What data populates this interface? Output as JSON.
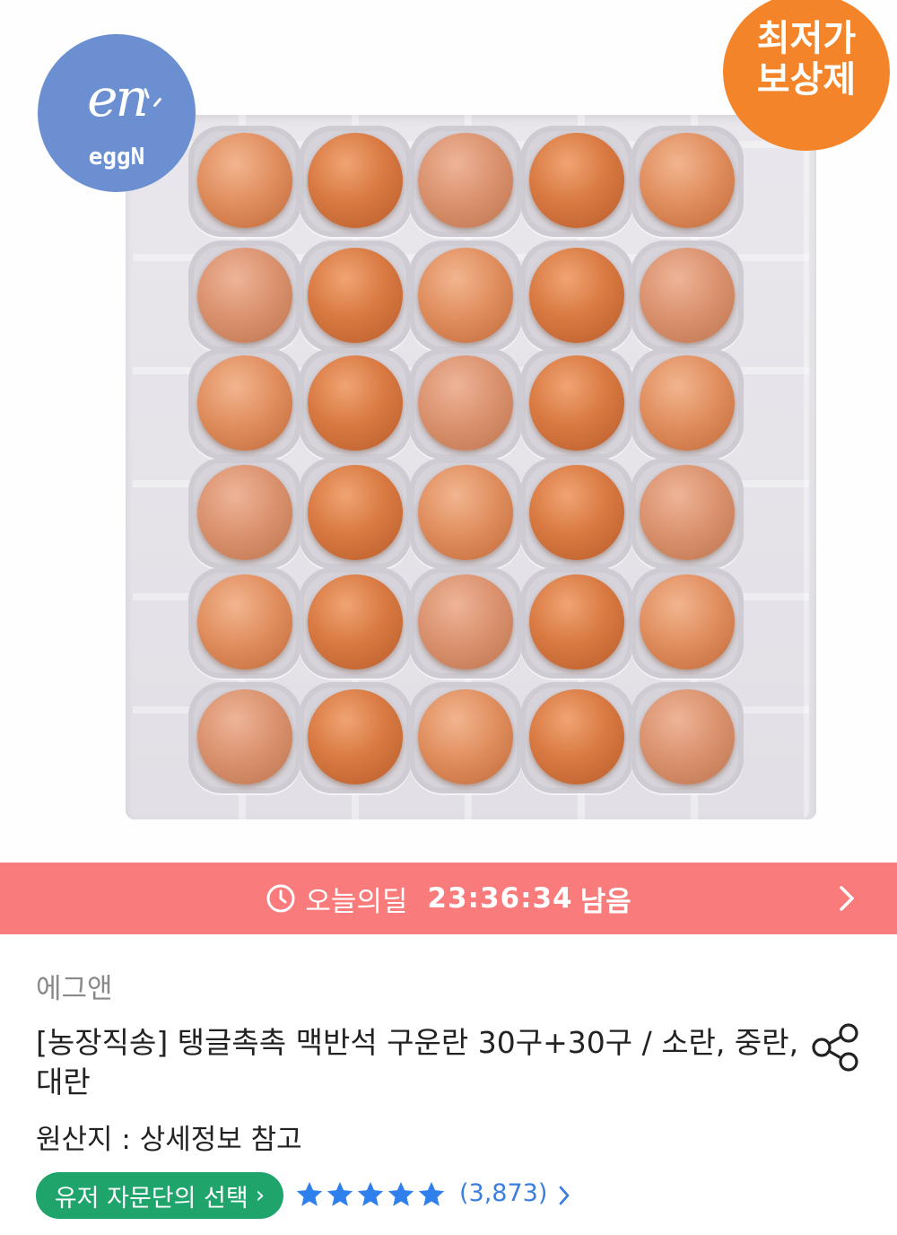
{
  "badges": {
    "logo_word": "eggN",
    "logo_mark": "en",
    "price_line1": "최저가",
    "price_line2": "보상제"
  },
  "deal": {
    "label": "오늘의딜",
    "countdown": "23:36:34",
    "suffix": "남음",
    "icon": "clock-icon"
  },
  "product": {
    "brand": "에그앤",
    "title": "[농장직송] 탱글촉촉 맥반석 구운란 30구+30구 / 소란, 중란,대란",
    "origin": "원산지 : 상세정보 참고"
  },
  "advisor": {
    "label": "유저 자문단의 선택",
    "chevron": "›"
  },
  "rating": {
    "stars": 5,
    "review_count": "(3,873)"
  },
  "colors": {
    "deal_bar": "#fa7b7b",
    "advisor_green": "#1fa46b",
    "star_blue": "#2f80ed",
    "price_badge": "#f48429",
    "logo_badge": "#6b8fd0"
  }
}
